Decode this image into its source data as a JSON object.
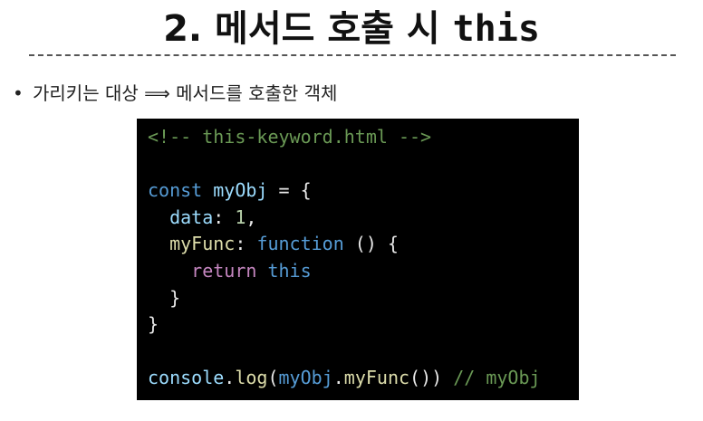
{
  "slide": {
    "title_prefix": "2. 메서드 호출 시 ",
    "title_code": "this",
    "bullet_symbol": "•",
    "bullet_text": "가리키는 대상 ⟹ 메서드를 호출한 객체"
  },
  "code": {
    "line1_comment": "<!-- this-keyword.html -->",
    "line3_const": "const",
    "line3_var": "myObj",
    "line3_rest": " = {",
    "line4_prop": "data",
    "line4_colon": ": ",
    "line4_num": "1",
    "line4_end": ",",
    "line5_prop": "myFunc",
    "line5_colon": ": ",
    "line5_kw": "function",
    "line5_rest": " () {",
    "line6_return": "return",
    "line6_this": "this",
    "line7_close": "}",
    "line8_close": "}",
    "line10_obj": "console",
    "line10_dot1": ".",
    "line10_fn": "log",
    "line10_paren1": "(",
    "line10_ref": "myObj",
    "line10_dot2": ".",
    "line10_method": "myFunc",
    "line10_paren2": "())",
    "line10_comment": " // myObj"
  }
}
